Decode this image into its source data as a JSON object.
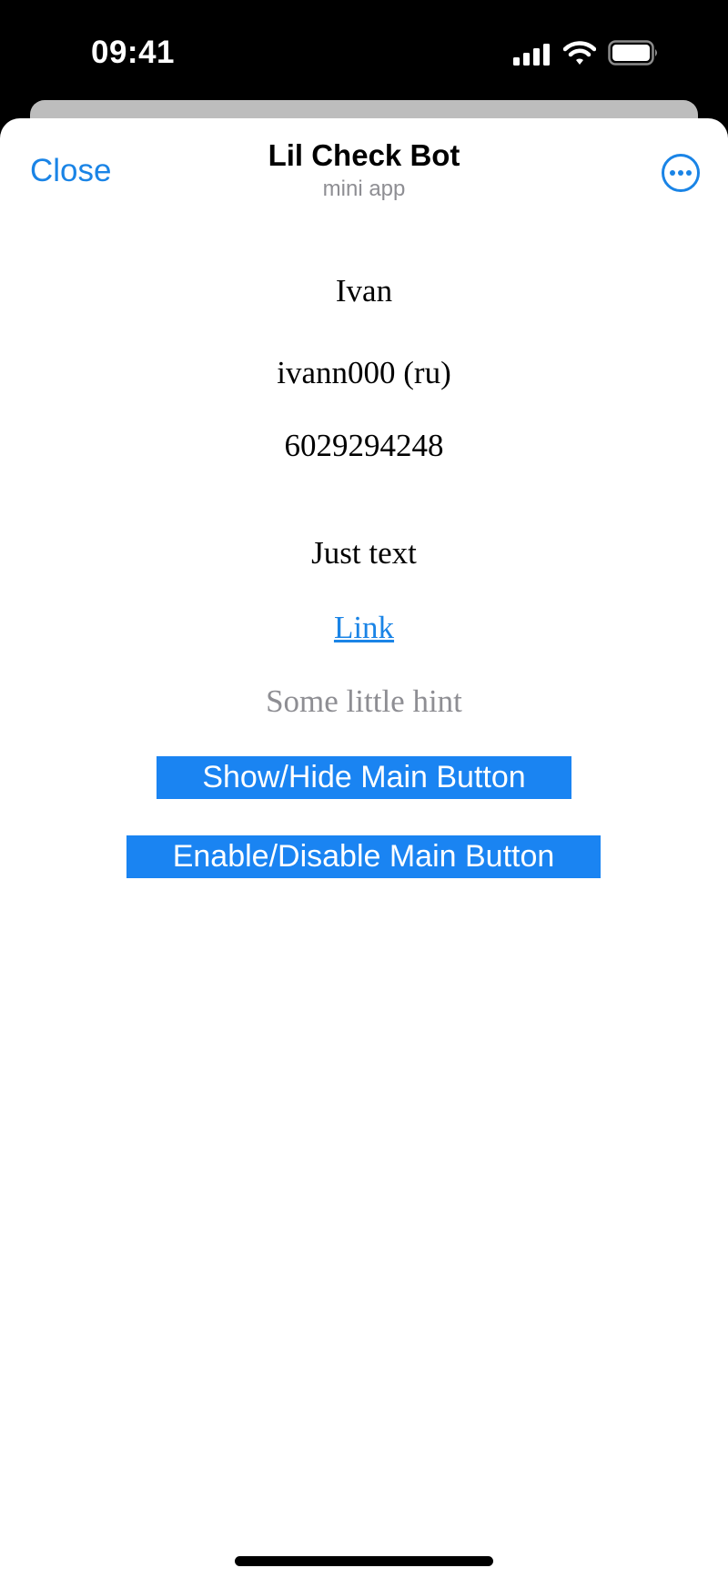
{
  "status_bar": {
    "time": "09:41",
    "icons": [
      "cellular-signal-icon",
      "wifi-icon",
      "battery-icon"
    ]
  },
  "nav": {
    "close_label": "Close",
    "title": "Lil Check Bot",
    "subtitle": "mini app",
    "more_icon": "ellipsis-circle-icon"
  },
  "user": {
    "first_name": "Ivan",
    "username_lang": "ivann000 (ru)",
    "id": "6029294248"
  },
  "content": {
    "just_text": "Just text",
    "link_label": "Link",
    "hint": "Some little hint"
  },
  "buttons": {
    "show_hide": "Show/Hide Main Button",
    "enable_disable": "Enable/Disable Main Button"
  },
  "colors": {
    "accent": "#1a84e6",
    "button_bg": "#1a84f2",
    "hint": "#8e8e93"
  }
}
